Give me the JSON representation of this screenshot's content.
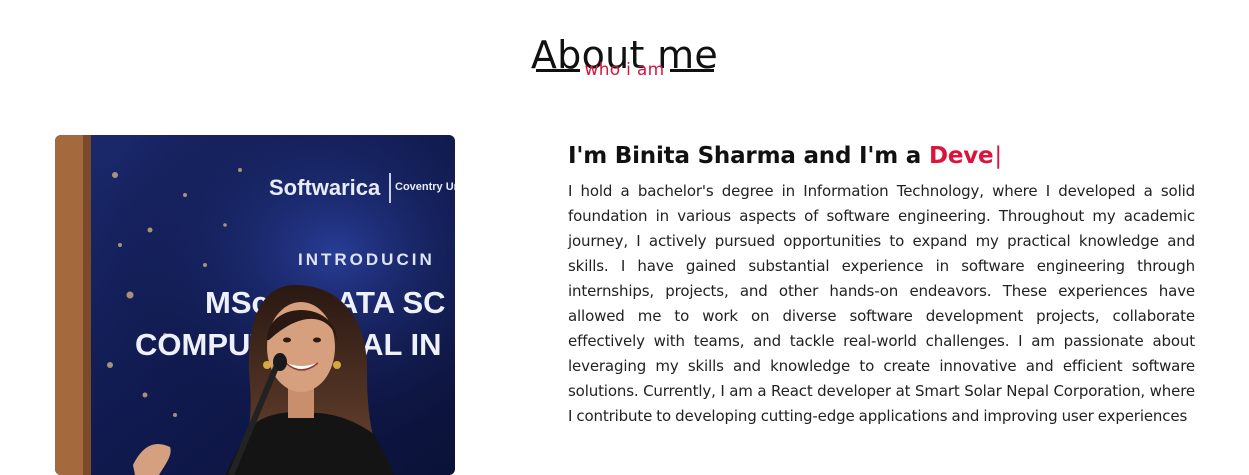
{
  "section": {
    "title": "About me",
    "subtitle": "who i am"
  },
  "colors": {
    "accent": "#dc143c",
    "text": "#111111",
    "background": "#ffffff"
  },
  "photo": {
    "backdrop_brand": "Softwarica",
    "backdrop_partner": "Coventry University",
    "backdrop_line1": "INTRODUCIN",
    "backdrop_line2": "MSc in DATA SC",
    "backdrop_line3": "COMPUTATIONAL IN"
  },
  "about": {
    "intro_prefix": "I'm Binita Sharma and I'm a ",
    "typed_text": "Deve",
    "cursor": "|",
    "bio": "I hold a bachelor's degree in Information Technology, where I developed a solid foundation in various aspects of software engineering. Throughout my academic journey, I actively pursued opportunities to expand my practical knowledge and skills. I have gained substantial experience in software engineering through internships, projects, and other hands-on endeavors. These experiences have allowed me to work on diverse software development projects, collaborate effectively with teams, and tackle real-world challenges. I am passionate about leveraging my skills and knowledge to create innovative and efficient software solutions. Currently, I am a React developer at Smart Solar Nepal Corporation, where I contribute to developing cutting-edge applications and improving user experiences"
  }
}
